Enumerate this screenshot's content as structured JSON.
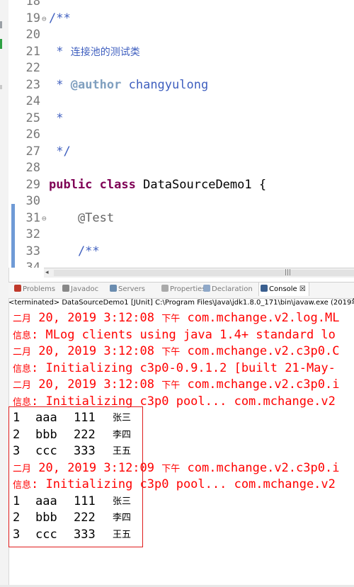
{
  "editor": {
    "lines": [
      {
        "num": "18",
        "fold": "",
        "parts": [
          {
            "t": "",
            "c": ""
          }
        ]
      },
      {
        "num": "19",
        "fold": "⊖",
        "parts": [
          {
            "t": "/**",
            "c": "cm"
          }
        ]
      },
      {
        "num": "20",
        "fold": "",
        "parts": [
          {
            "t": "",
            "c": ""
          }
        ]
      },
      {
        "num": "21",
        "fold": "",
        "parts": [
          {
            "t": " * ",
            "c": "cm"
          },
          {
            "t": "连接池的测试类",
            "c": "cm cn"
          }
        ]
      },
      {
        "num": "22",
        "fold": "",
        "parts": [
          {
            "t": "",
            "c": ""
          }
        ]
      },
      {
        "num": "23",
        "fold": "",
        "parts": [
          {
            "t": " * ",
            "c": "cm"
          },
          {
            "t": "@author",
            "c": "tag"
          },
          {
            "t": " changyulong",
            "c": "cm"
          }
        ]
      },
      {
        "num": "24",
        "fold": "",
        "parts": [
          {
            "t": "",
            "c": ""
          }
        ]
      },
      {
        "num": "25",
        "fold": "",
        "parts": [
          {
            "t": " *",
            "c": "cm"
          }
        ]
      },
      {
        "num": "26",
        "fold": "",
        "parts": [
          {
            "t": "",
            "c": ""
          }
        ]
      },
      {
        "num": "27",
        "fold": "",
        "parts": [
          {
            "t": " */",
            "c": "cm"
          }
        ]
      },
      {
        "num": "28",
        "fold": "",
        "parts": [
          {
            "t": "",
            "c": ""
          }
        ]
      },
      {
        "num": "29",
        "fold": "",
        "parts": [
          {
            "t": "public",
            "c": "kw"
          },
          {
            "t": " ",
            "c": ""
          },
          {
            "t": "class",
            "c": "kw"
          },
          {
            "t": " DataSourceDemo1 {",
            "c": ""
          }
        ]
      },
      {
        "num": "30",
        "fold": "",
        "parts": [
          {
            "t": "",
            "c": ""
          }
        ]
      },
      {
        "num": "31",
        "fold": "⊖",
        "parts": [
          {
            "t": "    @Test",
            "c": "ann"
          }
        ]
      },
      {
        "num": "32",
        "fold": "",
        "parts": [
          {
            "t": "",
            "c": ""
          }
        ]
      },
      {
        "num": "33",
        "fold": "",
        "parts": [
          {
            "t": "    /**",
            "c": "cm"
          }
        ]
      },
      {
        "num": "34",
        "fold": "",
        "parts": [
          {
            "t": "",
            "c": ""
          }
        ]
      }
    ]
  },
  "scrollbar": {
    "left_arrow": "◂",
    "grip": "|||"
  },
  "tabs": [
    {
      "label": "Problems",
      "icon": "problems-icon",
      "color": "#c0392b"
    },
    {
      "label": "Javadoc",
      "icon": "javadoc-icon",
      "color": "#888888"
    },
    {
      "label": "Servers",
      "icon": "servers-icon",
      "color": "#6a8caf"
    },
    {
      "label": "Properties",
      "icon": "properties-icon",
      "color": "#aaaaaa"
    },
    {
      "label": "Declaration",
      "icon": "declaration-icon",
      "color": "#8fa8c8"
    },
    {
      "label": "Console",
      "icon": "console-icon",
      "color": "#3a5f8f",
      "active": true,
      "close": "☒"
    }
  ],
  "console": {
    "header": "<terminated> DataSourceDemo1 [JUnit] C:\\Program Files\\Java\\jdk1.8.0_171\\bin\\javaw.exe (2019年2",
    "lines": [
      {
        "kind": "err",
        "segs": [
          {
            "t": "二月",
            "cn": true
          },
          {
            "t": " 20, 2019 3:12:08 "
          },
          {
            "t": "下午",
            "cn": true
          },
          {
            "t": " com.mchange.v2.log.ML"
          }
        ]
      },
      {
        "kind": "err",
        "segs": [
          {
            "t": "信息",
            "cn": true
          },
          {
            "t": ": MLog clients using java 1.4+ standard lo"
          }
        ]
      },
      {
        "kind": "err",
        "segs": [
          {
            "t": "二月",
            "cn": true
          },
          {
            "t": " 20, 2019 3:12:08 "
          },
          {
            "t": "下午",
            "cn": true
          },
          {
            "t": " com.mchange.v2.c3p0.C"
          }
        ]
      },
      {
        "kind": "err",
        "segs": [
          {
            "t": "信息",
            "cn": true
          },
          {
            "t": ": Initializing c3p0-0.9.1.2 [built 21-May-"
          }
        ]
      },
      {
        "kind": "err",
        "segs": [
          {
            "t": "二月",
            "cn": true
          },
          {
            "t": " 20, 2019 3:12:08 "
          },
          {
            "t": "下午",
            "cn": true
          },
          {
            "t": " com.mchange.v2.c3p0.i"
          }
        ]
      },
      {
        "kind": "err",
        "segs": [
          {
            "t": "信息",
            "cn": true
          },
          {
            "t": ": Initializing c3p0 pool... com.mchange.v2"
          }
        ]
      },
      {
        "kind": "out",
        "row": [
          "1",
          "aaa",
          "111",
          "张三"
        ]
      },
      {
        "kind": "out",
        "row": [
          "2",
          "bbb",
          "222",
          "李四"
        ]
      },
      {
        "kind": "out",
        "row": [
          "3",
          "ccc",
          "333",
          "王五"
        ]
      },
      {
        "kind": "err",
        "segs": [
          {
            "t": "二月",
            "cn": true
          },
          {
            "t": " 20, 2019 3:12:09 "
          },
          {
            "t": "下午",
            "cn": true
          },
          {
            "t": " com.mchange.v2.c3p0.i"
          }
        ]
      },
      {
        "kind": "err",
        "segs": [
          {
            "t": "信息",
            "cn": true
          },
          {
            "t": ": Initializing c3p0 pool... com.mchange.v2"
          }
        ]
      },
      {
        "kind": "out",
        "row": [
          "1",
          "aaa",
          "111",
          "张三"
        ]
      },
      {
        "kind": "out",
        "row": [
          "2",
          "bbb",
          "222",
          "李四"
        ]
      },
      {
        "kind": "out",
        "row": [
          "3",
          "ccc",
          "333",
          "王五"
        ]
      }
    ]
  },
  "colors": {
    "error_text": "#ff0000",
    "highlight_box": "#e01b1b",
    "keyword": "#7f0055",
    "comment": "#3f5fbf"
  }
}
